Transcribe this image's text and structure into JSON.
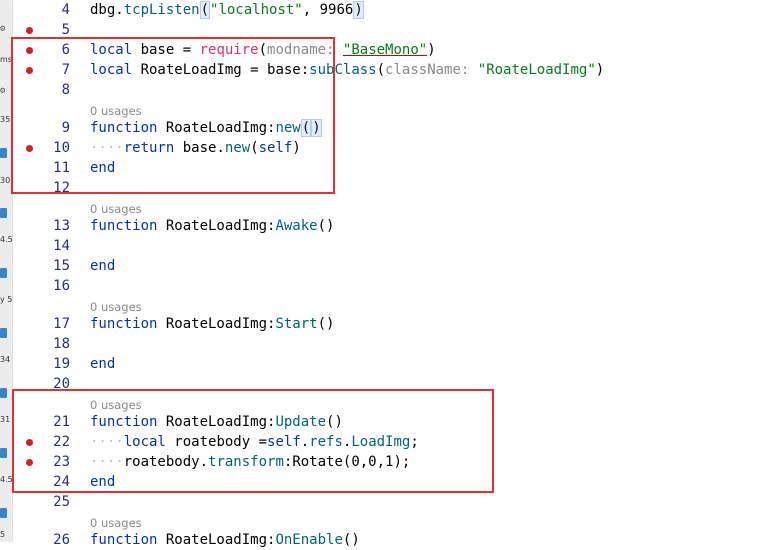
{
  "sidebar": {
    "fragments": [
      "ms",
      "35",
      "30",
      "4.5",
      "y 5",
      "34",
      "31",
      "4.5",
      "5"
    ]
  },
  "lines": [
    {
      "n": "4",
      "tokens": [
        [
          "fn",
          "dbg."
        ],
        [
          "mth",
          "tcpListen"
        ],
        [
          "paren",
          "("
        ],
        [
          "str",
          "\"localhost\""
        ],
        [
          "fn",
          ", "
        ],
        [
          "fn",
          "9966"
        ],
        [
          "paren",
          ")"
        ]
      ]
    },
    {
      "n": "5",
      "bp": true,
      "tokens": []
    },
    {
      "n": "6",
      "bp": true,
      "tokens": [
        [
          "kw",
          "local "
        ],
        [
          "fn",
          "base "
        ],
        [
          "fn",
          "= "
        ],
        [
          "req",
          "require"
        ],
        [
          "fn",
          "("
        ],
        [
          "hint",
          "modname: "
        ],
        [
          "strU",
          "\"BaseMono\""
        ],
        [
          "fn",
          ")"
        ]
      ]
    },
    {
      "n": "7",
      "bp": true,
      "tokens": [
        [
          "kw",
          "local "
        ],
        [
          "fn",
          "RoateLoadImg "
        ],
        [
          "fn",
          "= "
        ],
        [
          "fn",
          "base"
        ],
        [
          "fn",
          ":"
        ],
        [
          "mth",
          "subClass"
        ],
        [
          "fn",
          "("
        ],
        [
          "hint",
          "className: "
        ],
        [
          "str",
          "\"RoateLoadImg\""
        ],
        [
          "fn",
          ")"
        ]
      ]
    },
    {
      "n": "8",
      "tokens": []
    },
    {
      "n": "9",
      "usages": "0 usages",
      "tokens": [
        [
          "kw",
          "function "
        ],
        [
          "fn",
          "RoateLoadImg"
        ],
        [
          "fn",
          ":"
        ],
        [
          "mth",
          "new"
        ],
        [
          "paren",
          "("
        ],
        [
          "paren",
          ")"
        ]
      ]
    },
    {
      "n": "10",
      "bp": true,
      "tokens": [
        [
          "dim",
          "····"
        ],
        [
          "kw",
          "return "
        ],
        [
          "fn",
          "base"
        ],
        [
          "fn",
          "."
        ],
        [
          "mth",
          "new"
        ],
        [
          "fn",
          "("
        ],
        [
          "kw",
          "self"
        ],
        [
          "fn",
          ")"
        ]
      ]
    },
    {
      "n": "11",
      "tokens": [
        [
          "kw",
          "end"
        ]
      ]
    },
    {
      "n": "12",
      "tokens": []
    },
    {
      "n": "13",
      "usages": "0 usages",
      "tokens": [
        [
          "kw",
          "function "
        ],
        [
          "fn",
          "RoateLoadImg"
        ],
        [
          "fn",
          ":"
        ],
        [
          "mth",
          "Awake"
        ],
        [
          "fn",
          "()"
        ]
      ]
    },
    {
      "n": "14",
      "tokens": []
    },
    {
      "n": "15",
      "tokens": [
        [
          "kw",
          "end"
        ]
      ]
    },
    {
      "n": "16",
      "tokens": []
    },
    {
      "n": "17",
      "usages": "0 usages",
      "tokens": [
        [
          "kw",
          "function "
        ],
        [
          "fn",
          "RoateLoadImg"
        ],
        [
          "fn",
          ":"
        ],
        [
          "mth",
          "Start"
        ],
        [
          "fn",
          "()"
        ]
      ]
    },
    {
      "n": "18",
      "tokens": []
    },
    {
      "n": "19",
      "tokens": [
        [
          "kw",
          "end"
        ]
      ]
    },
    {
      "n": "20",
      "tokens": []
    },
    {
      "n": "21",
      "usages": "0 usages",
      "tokens": [
        [
          "kw",
          "function "
        ],
        [
          "fn",
          "RoateLoadImg"
        ],
        [
          "fn",
          ":"
        ],
        [
          "mth",
          "Update"
        ],
        [
          "fn",
          "()"
        ]
      ]
    },
    {
      "n": "22",
      "bp": true,
      "tokens": [
        [
          "dim",
          "····"
        ],
        [
          "kw",
          "local "
        ],
        [
          "fn",
          "roatebody "
        ],
        [
          "fn",
          "="
        ],
        [
          "kw",
          "self"
        ],
        [
          "fn",
          "."
        ],
        [
          "mth",
          "refs"
        ],
        [
          "fn",
          "."
        ],
        [
          "mth",
          "LoadImg"
        ],
        [
          "fn",
          ";"
        ]
      ]
    },
    {
      "n": "23",
      "bp": true,
      "tokens": [
        [
          "dim",
          "····"
        ],
        [
          "fn",
          "roatebody"
        ],
        [
          "fn",
          "."
        ],
        [
          "mth",
          "transform"
        ],
        [
          "fn",
          ":"
        ],
        [
          "fn",
          "Rotate"
        ],
        [
          "fn",
          "("
        ],
        [
          "fn",
          "0,0,1"
        ],
        [
          "fn",
          ");"
        ]
      ]
    },
    {
      "n": "24",
      "tokens": [
        [
          "kw",
          "end"
        ]
      ]
    },
    {
      "n": "25",
      "tokens": []
    },
    {
      "n": "26",
      "usages": "0 usages",
      "tokens": [
        [
          "kw",
          "function "
        ],
        [
          "fn",
          "RoateLoadImg"
        ],
        [
          "fn",
          ":"
        ],
        [
          "mth",
          "OnEnable"
        ],
        [
          "fn",
          "()"
        ]
      ]
    }
  ]
}
